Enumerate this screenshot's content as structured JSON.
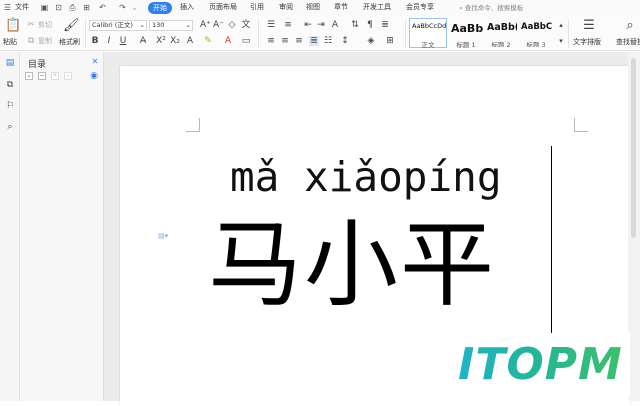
{
  "menubar": {
    "file_label": "文件",
    "tabs": [
      "开始",
      "插入",
      "页面布局",
      "引用",
      "审阅",
      "视图",
      "章节",
      "开发工具",
      "会员专享"
    ],
    "active_tab": "开始",
    "search_placeholder": "查找命令、搜索模板"
  },
  "ribbon": {
    "paste_label": "粘贴",
    "cut_label": "剪切",
    "copy_label": "复制",
    "format_painter_label": "格式刷",
    "font_name": "Calibri (正文)",
    "font_size": "130",
    "styles": [
      {
        "sample": "AaBbCcDd",
        "name": "正文"
      },
      {
        "sample": "AaBb",
        "name": "标题 1"
      },
      {
        "sample": "AaBb(",
        "name": "标题 2"
      },
      {
        "sample": "AaBbC",
        "name": "标题 3"
      }
    ],
    "text_layout_label": "文字排版",
    "find_replace_label": "查找替换"
  },
  "toc": {
    "title": "目录"
  },
  "document": {
    "pinyin": "mǎ xiǎopíng",
    "hanzi": "马小平"
  },
  "watermark": {
    "text": "ITOPM"
  },
  "colors": {
    "accent": "#2f7ff0",
    "watermark_start": "#1fb4c9",
    "watermark_end": "#3cc06a"
  }
}
